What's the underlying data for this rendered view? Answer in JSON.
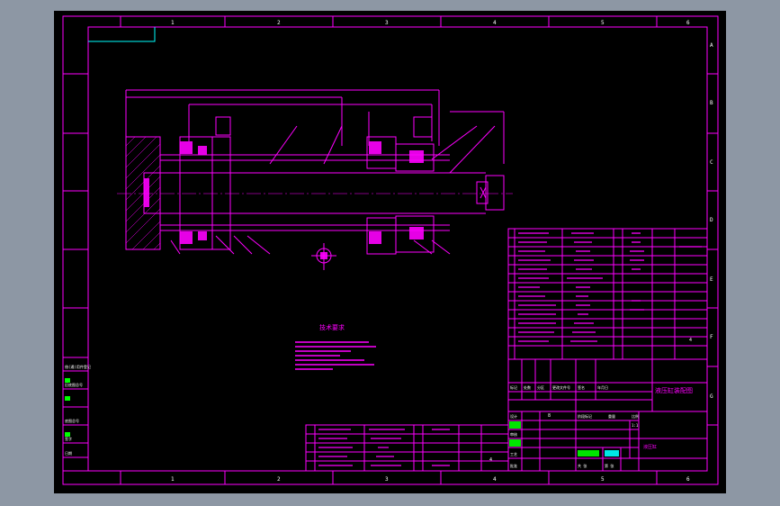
{
  "colors": {
    "background": "#8d97a4",
    "viewport": "#000000",
    "magenta": "#ff00ff",
    "cyan": "#00ffff",
    "white": "#ffffff",
    "green": "#00ff00",
    "yellow": "#ffff00"
  },
  "frame": {
    "top_zones": [
      "1",
      "2",
      "3",
      "4",
      "5",
      "6"
    ],
    "bottom_zones": [
      "1",
      "2",
      "3",
      "4",
      "5",
      "6"
    ],
    "right_zones": [
      "A",
      "B",
      "C",
      "D",
      "E",
      "F",
      "G"
    ]
  },
  "drawing": {
    "tech_title": "技术要求",
    "title_block_name": "液压缸装配图",
    "company_name": "液压缸"
  },
  "title_block": {
    "design": "设计",
    "check": "审核",
    "process": "工艺",
    "approve": "批准",
    "mark": "标记",
    "count": "处数",
    "zone": "分区",
    "doc_no": "更改文件号",
    "sign": "签名",
    "date": "年月日",
    "stage_mark": "阶段标记",
    "weight": "重量",
    "scale": "比例",
    "sheet_total": "共 张",
    "sheet_no": "第 张",
    "scale_value": "1:1"
  },
  "left_strip": {
    "label1": "借(通)用件登记",
    "label2": "旧底图总号",
    "label3": "底图总号",
    "label4": "签字",
    "label5": "日期"
  }
}
